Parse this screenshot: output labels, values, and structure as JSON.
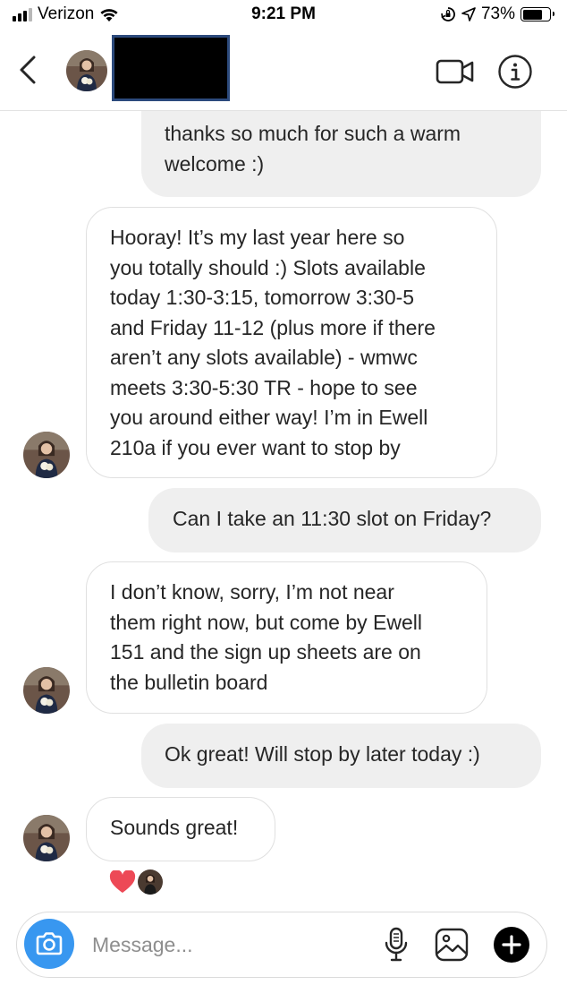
{
  "status_bar": {
    "carrier": "Verizon",
    "time": "9:21 PM",
    "battery": "73%",
    "battery_level": 0.73
  },
  "header": {
    "contact_name_redacted": true
  },
  "messages": [
    {
      "direction": "out",
      "text": "thanks so much for such a warm\nwelcome :)"
    },
    {
      "direction": "in",
      "text": "Hooray! It’s my last year here so\nyou totally should :) Slots available\ntoday 1:30-3:15, tomorrow 3:30-5\nand Friday 11-12 (plus more if there\naren’t any slots available) - wmwc\nmeets 3:30-5:30 TR - hope to see\nyou around either way! I’m in Ewell\n210a if you ever want to stop by"
    },
    {
      "direction": "out",
      "text": "Can I take an 11:30 slot on Friday?"
    },
    {
      "direction": "in",
      "text": "I don’t know, sorry, I’m not near\nthem right now, but come by Ewell\n151 and the sign up sheets are on\nthe bulletin board"
    },
    {
      "direction": "out",
      "text": "Ok great! Will stop by later today :)"
    },
    {
      "direction": "in",
      "text": "Sounds great!"
    }
  ],
  "reaction": {
    "icon": "heart-icon",
    "color": "#ed4956"
  },
  "composer": {
    "placeholder": "Message...",
    "accent": "#3897f0"
  },
  "icons": [
    "back-chevron-icon",
    "video-call-icon",
    "info-icon",
    "camera-icon",
    "microphone-icon",
    "gallery-icon",
    "plus-circle-icon",
    "wifi-icon",
    "location-arrow-icon",
    "orientation-lock-icon"
  ]
}
